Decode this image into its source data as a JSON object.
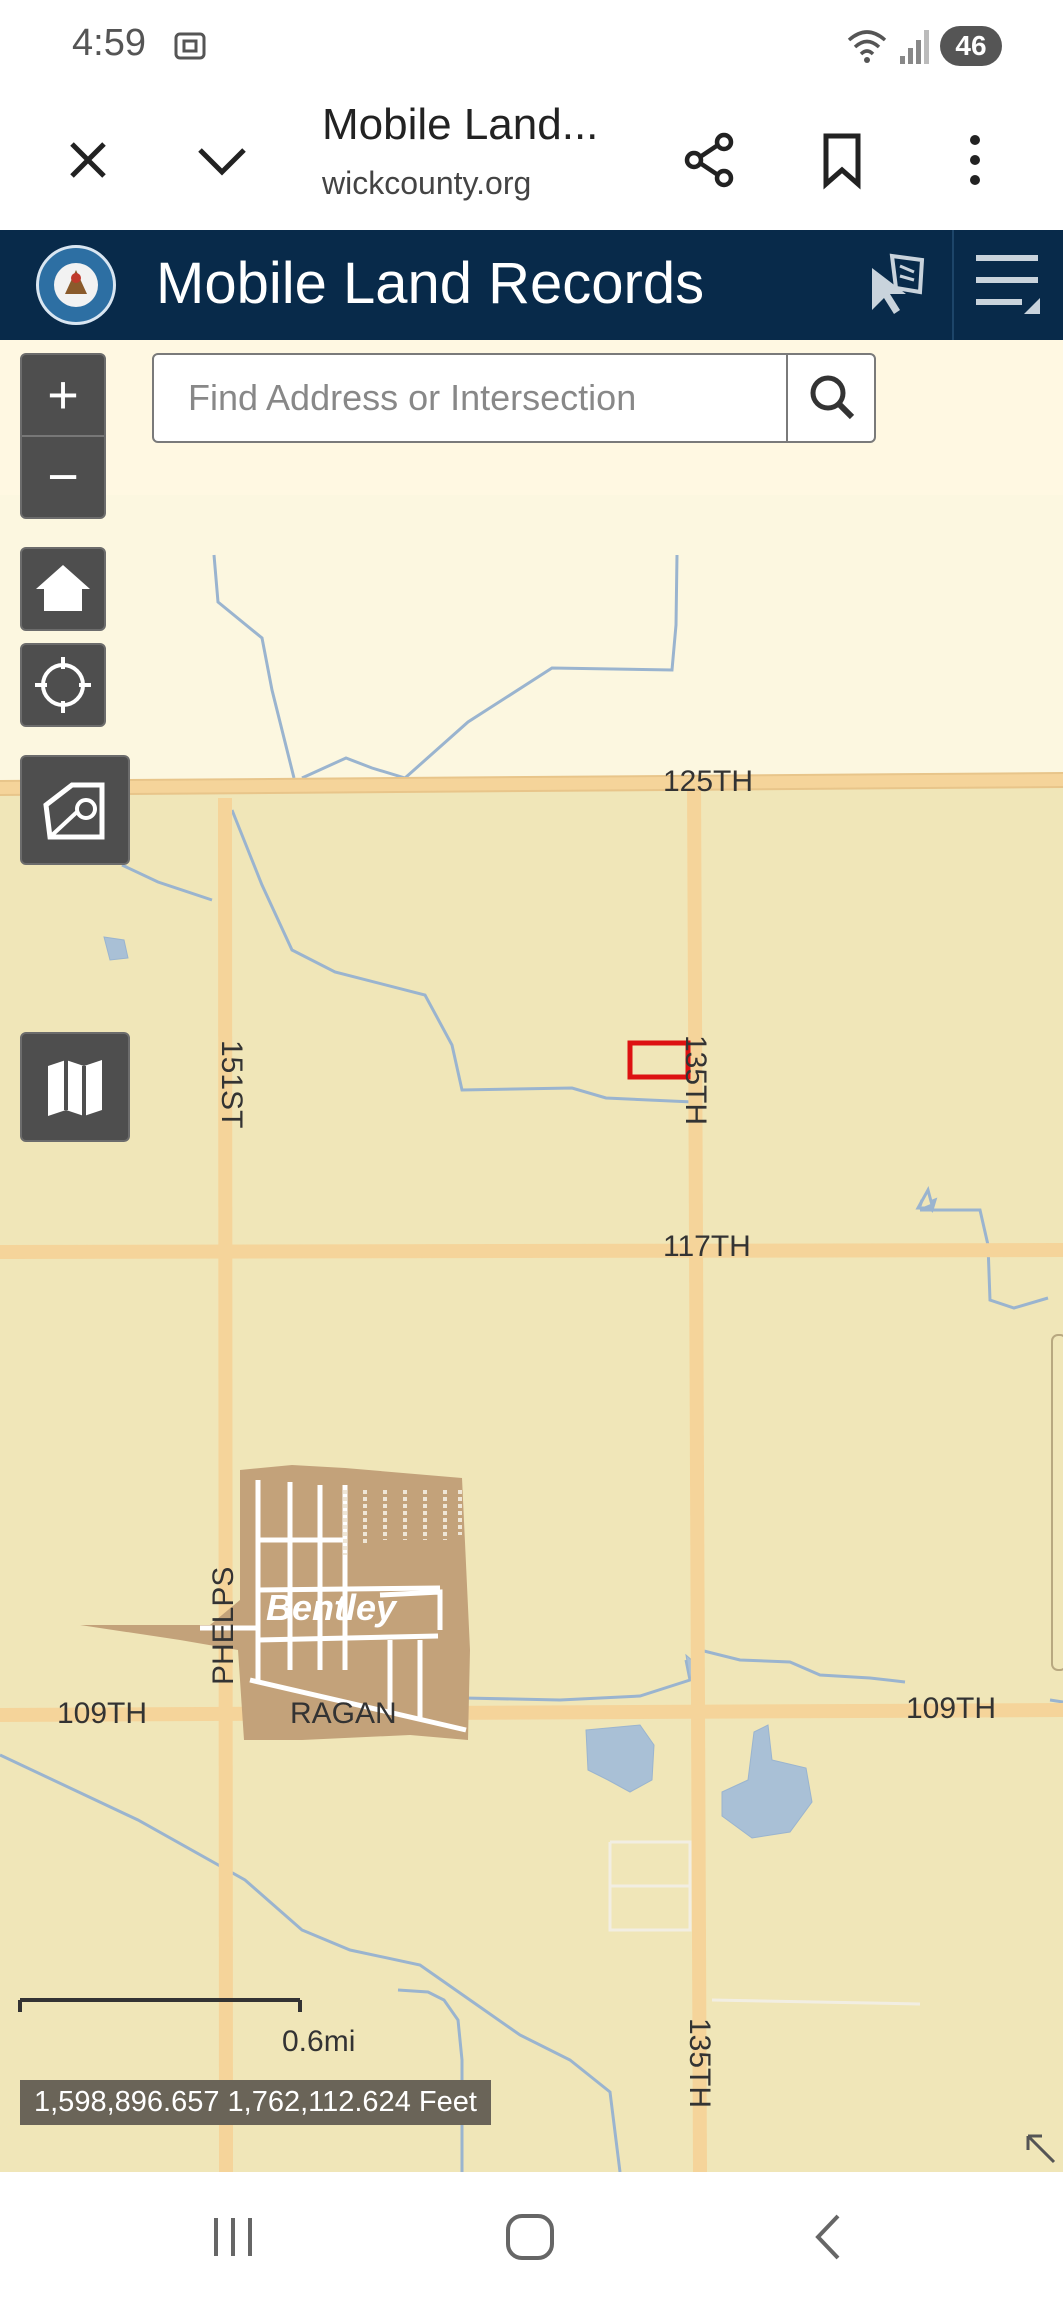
{
  "status_bar": {
    "time": "4:59",
    "battery": "46"
  },
  "browser": {
    "title": "Mobile Land...",
    "url": "wickcounty.org"
  },
  "app": {
    "title": "Mobile Land Records"
  },
  "search": {
    "placeholder": "Find Address or Intersection"
  },
  "zoom": {
    "in_label": "+",
    "out_label": "−"
  },
  "map": {
    "roads": {
      "r125th": "125TH",
      "r117th": "117TH",
      "r109th_left": "109TH",
      "r109th_right": "109TH",
      "r151st": "151ST",
      "r135th_upper": "135TH",
      "r135th_lower": "135TH",
      "phelps": "PHELPS",
      "ragan": "RAGAN"
    },
    "town": "Bentley",
    "scale": "0.6mi",
    "coordinates": "1,598,896.657 1,762,112.624 Feet",
    "colors": {
      "land": "#f0e6b8",
      "water_line": "#9ab4cf",
      "road": "#f5d49a",
      "town": "#c3a27a",
      "selected_parcel": "#dd1111"
    }
  },
  "icons": {
    "status": [
      "screenshot-icon",
      "wifi-icon",
      "signal-icon"
    ],
    "browser": [
      "close-icon",
      "chevron-down-icon",
      "share-icon",
      "bookmark-icon",
      "more-vert-icon"
    ],
    "header": [
      "select-tool-icon",
      "menu-icon"
    ],
    "map": [
      "home-icon",
      "locate-icon",
      "parcel-icon",
      "basemap-icon",
      "resize-icon"
    ],
    "nav": [
      "recents-icon",
      "home-nav-icon",
      "back-icon"
    ]
  }
}
